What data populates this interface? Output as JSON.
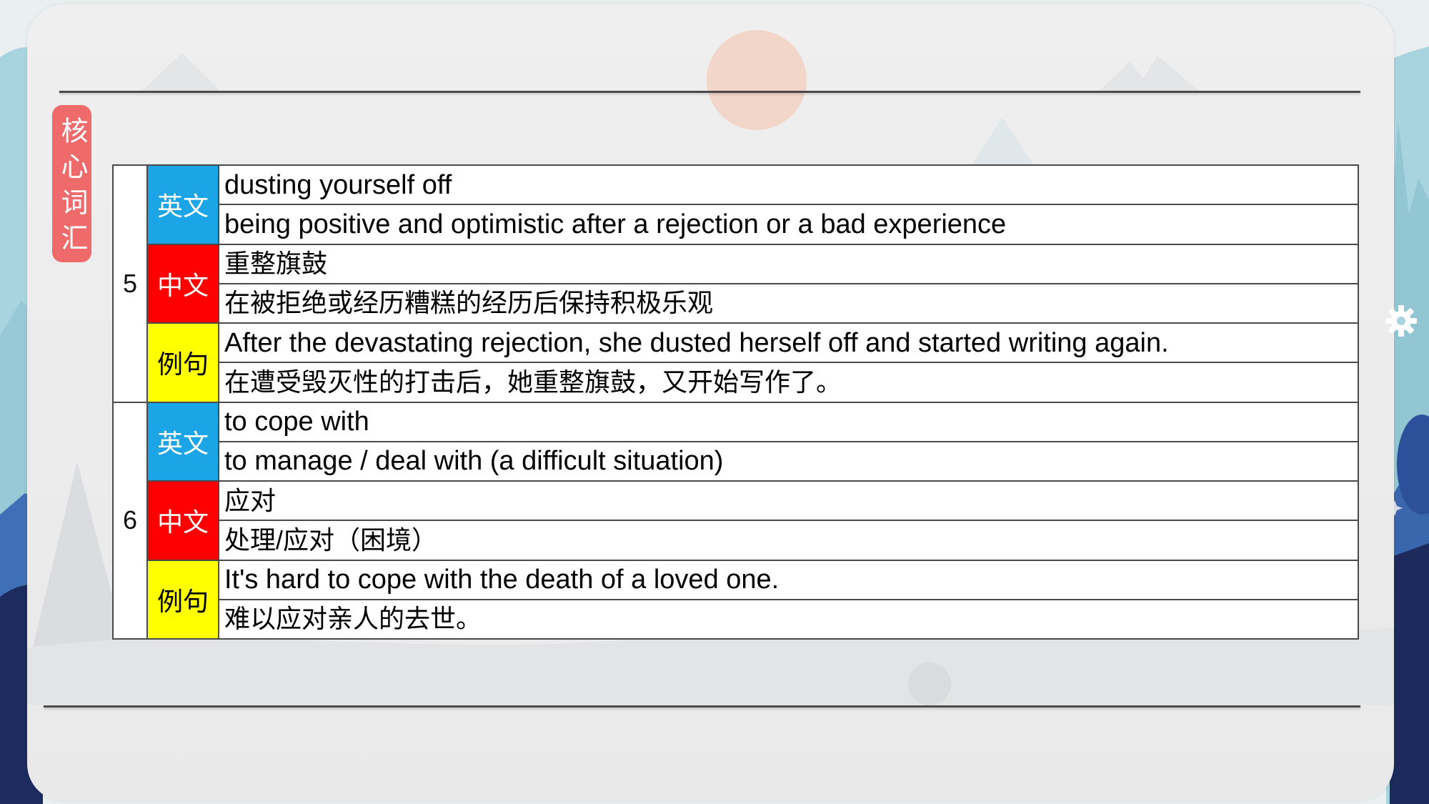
{
  "tag": {
    "text": "核心词汇",
    "bg": "#ef6a6a"
  },
  "label_styles": {
    "英文": {
      "bg": "#1ba5e6",
      "fg": "#ffffff"
    },
    "中文": {
      "bg": "#ff0000",
      "fg": "#ffffff"
    },
    "例句": {
      "bg": "#ffff00",
      "fg": "#000000"
    }
  },
  "icons": {
    "settings": "gear-icon",
    "sparkle": "sparkle-icon"
  },
  "entries": [
    {
      "number": "5",
      "groups": [
        {
          "label": "英文",
          "lines": [
            "dusting yourself off",
            "being positive and optimistic after a rejection or a bad experience"
          ]
        },
        {
          "label": "中文",
          "lines": [
            "重整旗鼓",
            "在被拒绝或经历糟糕的经历后保持积极乐观"
          ]
        },
        {
          "label": "例句",
          "lines": [
            "After the devastating rejection, she dusted herself off and started writing again.",
            "在遭受毁灭性的打击后，她重整旗鼓，又开始写作了。"
          ]
        }
      ]
    },
    {
      "number": "6",
      "groups": [
        {
          "label": "英文",
          "lines": [
            "to cope with",
            "to manage / deal with (a difficult situation)"
          ]
        },
        {
          "label": "中文",
          "lines": [
            "应对",
            "处理/应对（困境）"
          ]
        },
        {
          "label": "例句",
          "lines": [
            "It's hard to cope with the death of a loved one.",
            "难以应对亲人的去世。"
          ]
        }
      ]
    }
  ]
}
